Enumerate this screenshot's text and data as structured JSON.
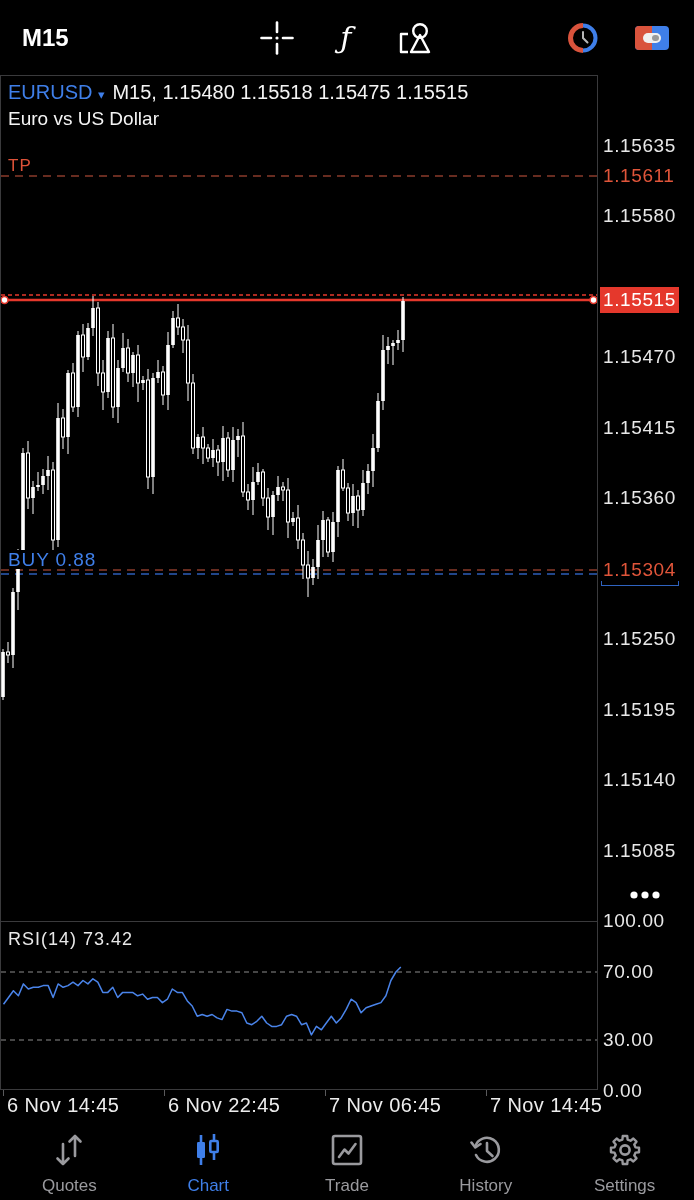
{
  "toolbar": {
    "timeframe": "M15",
    "function_button": "ƒ"
  },
  "symbol": {
    "name": "EURUSD",
    "caret": "▾",
    "quote": "M15, 1.15480 1.15518 1.15475 1.15515",
    "description": "Euro vs US Dollar"
  },
  "price_axis": {
    "labels": [
      "1.15635",
      "1.15580",
      "1.15470",
      "1.15415",
      "1.15360",
      "1.15250",
      "1.15195",
      "1.15140",
      "1.15085"
    ]
  },
  "price_lines": [
    {
      "kind": "take_profit",
      "label": "TP",
      "price": "1.15611"
    },
    {
      "kind": "bid",
      "price": "1.15515"
    },
    {
      "kind": "position",
      "label": "BUY 0.88",
      "price": "1.15304"
    }
  ],
  "indicator": {
    "chart_data": {
      "type": "line",
      "title": "RSI(14) 73.42",
      "categories": [
        null,
        null,
        null,
        null,
        null,
        null,
        null,
        null,
        null,
        null,
        null,
        null,
        null,
        null,
        null,
        null,
        null,
        null,
        null,
        null,
        null,
        null,
        null,
        null,
        null,
        null,
        null,
        null,
        null,
        null,
        null,
        null,
        null,
        null,
        null,
        null,
        null,
        null,
        null,
        null,
        null,
        null,
        null,
        null,
        null,
        null,
        null,
        null,
        null,
        null,
        null,
        null,
        null,
        null,
        null,
        null,
        null,
        null,
        null,
        null,
        null,
        null,
        null,
        null,
        null,
        null,
        null,
        null,
        null,
        null,
        null,
        null,
        null,
        null,
        null,
        null,
        null,
        null,
        null,
        null,
        null,
        null,
        null,
        null,
        null,
        null,
        null,
        null,
        null,
        null,
        null,
        null,
        null,
        null,
        null,
        null,
        null,
        null,
        null,
        null,
        null,
        null,
        null,
        null,
        null,
        null,
        null,
        null,
        null,
        null,
        null,
        null,
        null,
        null,
        null,
        null,
        null,
        null,
        null,
        null
      ],
      "series": [
        {
          "color": "#4a84ea",
          "values": [
            51,
            55,
            59,
            56,
            63,
            60,
            61,
            61,
            62,
            62,
            55,
            63,
            61,
            62,
            64,
            62,
            65,
            63,
            66,
            64,
            58,
            58,
            61,
            55,
            58,
            58,
            58,
            56,
            57,
            54,
            55,
            55,
            52,
            54,
            60,
            58,
            58,
            53,
            50,
            44,
            45,
            44,
            45,
            43,
            42,
            48,
            47,
            47,
            46,
            40,
            39,
            41,
            44,
            40,
            38,
            38,
            39,
            44,
            45,
            44,
            39,
            40,
            33,
            38,
            36,
            40,
            44,
            40,
            43,
            48,
            54,
            52,
            46,
            49,
            50,
            51,
            52,
            56,
            65,
            70,
            73,
            null,
            null,
            null,
            null,
            null,
            null,
            null,
            null,
            null,
            null,
            null,
            null,
            null,
            null,
            null,
            null,
            null,
            null,
            null,
            null,
            null,
            null,
            null,
            null,
            null,
            null,
            null,
            null,
            null,
            null,
            null,
            null,
            null,
            null,
            null,
            null,
            null,
            null,
            null
          ]
        }
      ],
      "ylim": [
        0,
        100
      ],
      "yticks": [
        {
          "value": 100,
          "label": "100.00"
        },
        {
          "value": 70,
          "label": "70.00"
        },
        {
          "value": 30,
          "label": "30.00"
        },
        {
          "value": 0,
          "label": "0.00"
        }
      ]
    }
  },
  "time_axis": {
    "labels": [
      "6 Nov 14:45",
      "6 Nov 22:45",
      "7 Nov 06:45",
      "7 Nov 14:45"
    ]
  },
  "tabs": [
    {
      "kind": "quotes",
      "label": "Quotes",
      "selected": false
    },
    {
      "kind": "chart",
      "label": "Chart",
      "selected": true
    },
    {
      "kind": "trade",
      "label": "Trade",
      "selected": false
    },
    {
      "kind": "history",
      "label": "History",
      "selected": false
    },
    {
      "kind": "settings",
      "label": "Settings",
      "selected": false
    }
  ]
}
